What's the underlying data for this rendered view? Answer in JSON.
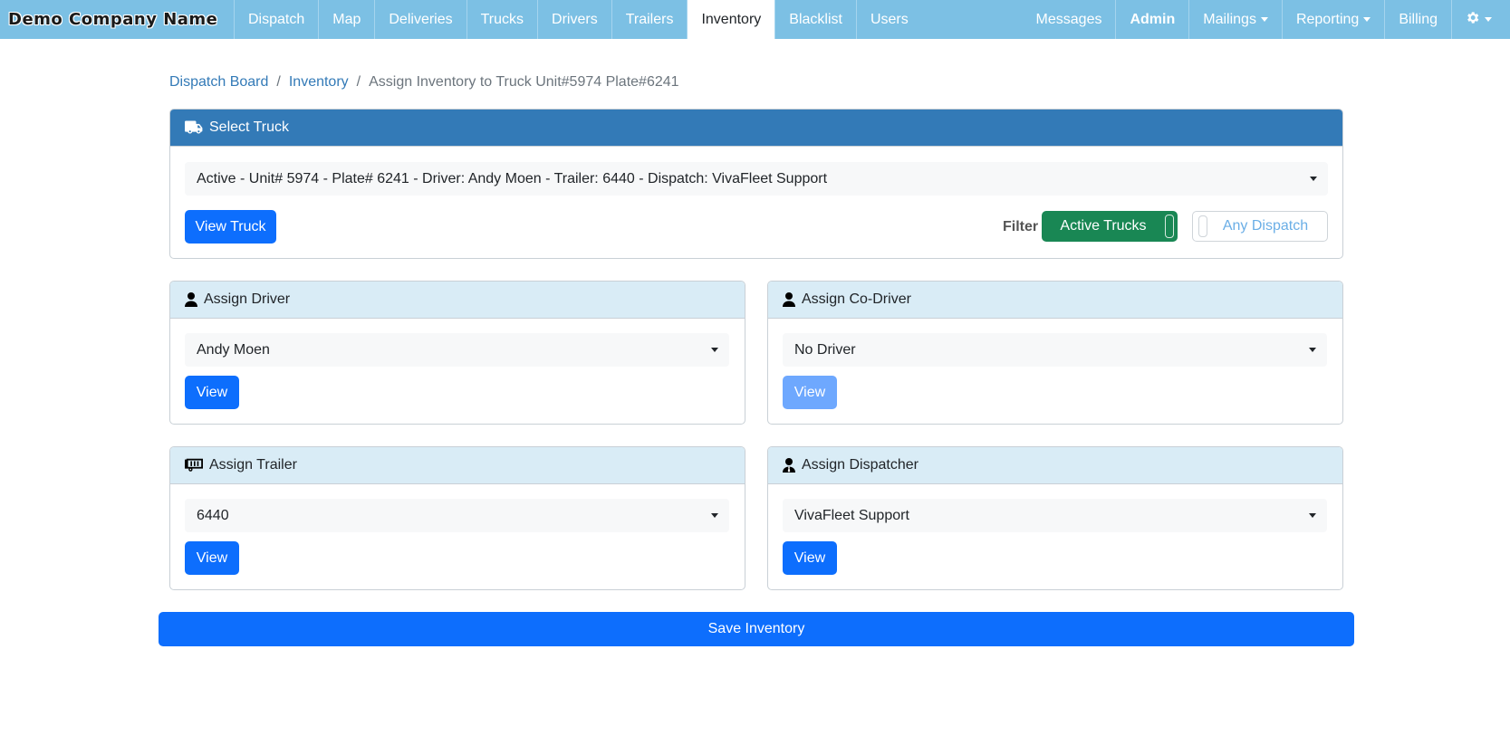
{
  "navbar": {
    "brand": "Demo Company Name",
    "left_items": [
      {
        "label": "Dispatch"
      },
      {
        "label": "Map"
      },
      {
        "label": "Deliveries"
      },
      {
        "label": "Trucks"
      },
      {
        "label": "Drivers"
      },
      {
        "label": "Trailers"
      },
      {
        "label": "Inventory"
      },
      {
        "label": "Blacklist"
      },
      {
        "label": "Users"
      }
    ],
    "active_item": "Inventory",
    "right_items": [
      {
        "label": "Messages"
      },
      {
        "label": "Admin"
      },
      {
        "label": "Mailings"
      },
      {
        "label": "Reporting"
      },
      {
        "label": "Billing"
      }
    ],
    "settings_icon": "gear-icon"
  },
  "breadcrumb": {
    "items": [
      "Dispatch Board",
      "Inventory"
    ],
    "current": "Assign Inventory to Truck Unit#5974 Plate#6241",
    "separator": "/"
  },
  "select_truck": {
    "title": "Select Truck",
    "icon": "truck-icon",
    "selected": "Active - Unit# 5974 - Plate# 6241 - Driver: Andy Moen - Trailer: 6440 - Dispatch: VivaFleet Support",
    "view_button": "View Truck",
    "filter_label": "Filter",
    "filter_active": "Active Trucks",
    "filter_dispatch": "Any Dispatch"
  },
  "assign_driver": {
    "title": "Assign Driver",
    "icon": "user-icon",
    "selected": "Andy Moen",
    "view_button": "View"
  },
  "assign_codriver": {
    "title": "Assign Co-Driver",
    "icon": "user-icon",
    "selected": "No Driver",
    "view_button": "View"
  },
  "assign_trailer": {
    "title": "Assign Trailer",
    "icon": "trailer-icon",
    "selected": "6440",
    "view_button": "View"
  },
  "assign_dispatcher": {
    "title": "Assign Dispatcher",
    "icon": "user-tie-icon",
    "selected": "VivaFleet Support",
    "view_button": "View"
  },
  "save_button": "Save Inventory",
  "colors": {
    "navbar": "#7cc0e4",
    "primary": "#0d6efd",
    "card_header_primary": "#337ab7",
    "card_header_light": "#d9ecf6",
    "success": "#198754"
  }
}
